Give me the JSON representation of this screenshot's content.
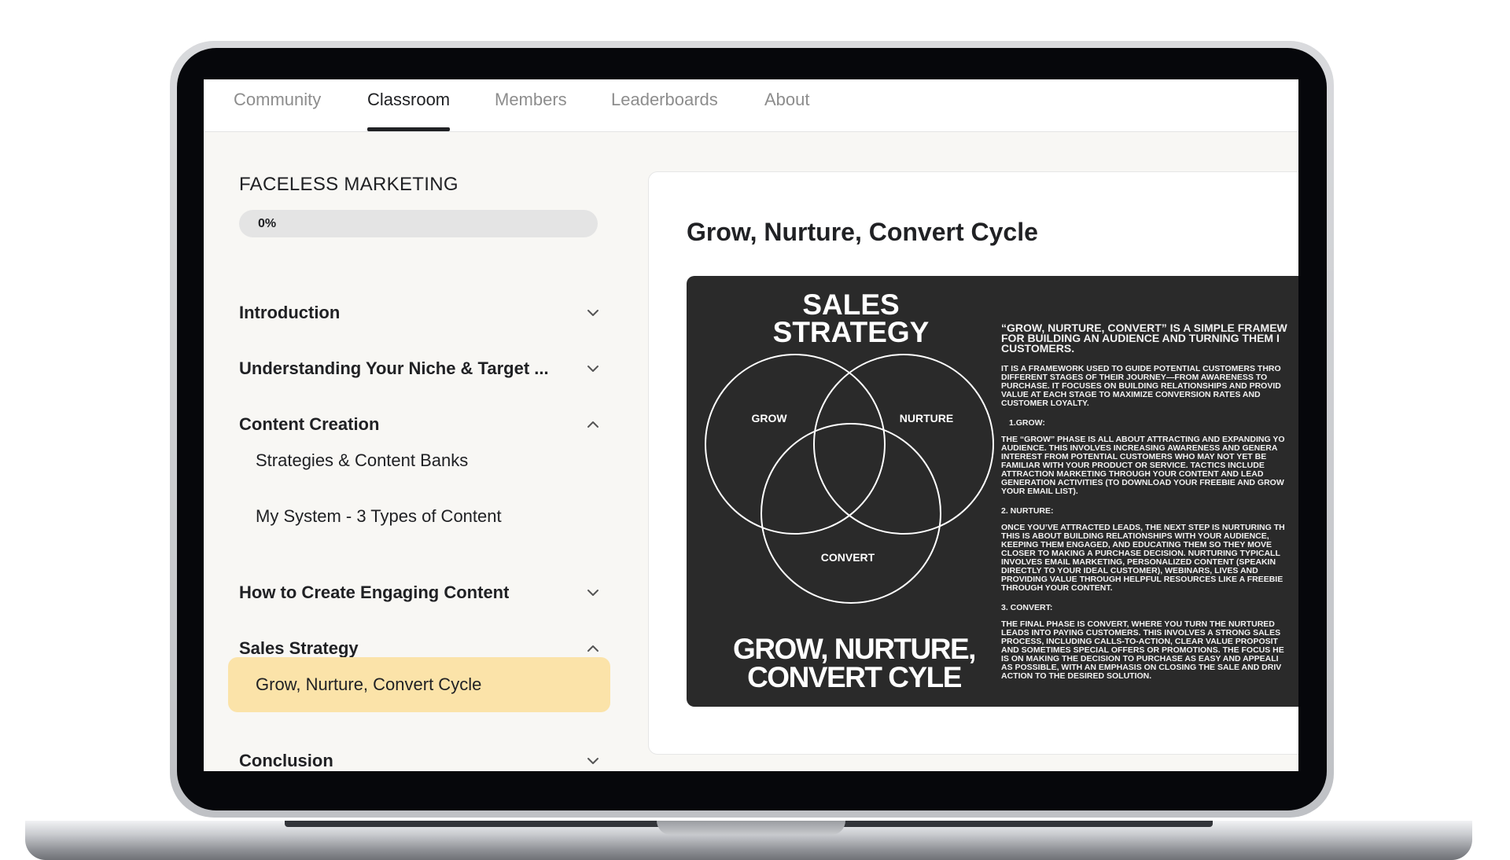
{
  "nav": {
    "tabs": [
      {
        "label": "Community"
      },
      {
        "label": "Classroom"
      },
      {
        "label": "Members"
      },
      {
        "label": "Leaderboards"
      },
      {
        "label": "About"
      }
    ]
  },
  "course": {
    "title": "FACELESS MARKETING",
    "progress_label": "0%",
    "progress_fraction": 0
  },
  "sections": [
    {
      "label": "Introduction",
      "expanded": false
    },
    {
      "label": "Understanding Your Niche & Target ...",
      "expanded": false
    },
    {
      "label": "Content Creation",
      "expanded": true,
      "lessons": [
        {
          "label": "Strategies & Content Banks"
        },
        {
          "label": "My System - 3 Types of Content"
        }
      ]
    },
    {
      "label": "How to Create Engaging Content",
      "expanded": false
    },
    {
      "label": "Sales Strategy",
      "expanded": true,
      "lessons": [
        {
          "label": "Grow, Nurture, Convert Cycle",
          "active": true
        }
      ]
    },
    {
      "label": "Conclusion",
      "expanded": false
    }
  ],
  "lesson": {
    "heading": "Grow, Nurture, Convert Cycle",
    "slide": {
      "title_line1": "SALES",
      "title_line2": "STRATEGY",
      "circle_grow": "GROW",
      "circle_nurture": "NURTURE",
      "circle_convert": "CONVERT",
      "bottom_line1": "GROW, NURTURE,",
      "bottom_line2": "CONVERT CYLE",
      "lead": [
        "“GROW, NURTURE, CONVERT” IS A SIMPLE FRAMEW",
        "FOR BUILDING AN AUDIENCE AND TURNING THEM I",
        "CUSTOMERS."
      ],
      "intro": [
        "IT IS A FRAMEWORK USED TO GUIDE POTENTIAL CUSTOMERS THRO",
        "DIFFERENT STAGES OF THEIR JOURNEY—FROM AWARENESS TO",
        "PURCHASE. IT FOCUSES ON BUILDING RELATIONSHIPS AND PROVID",
        "VALUE AT EACH STAGE TO MAXIMIZE CONVERSION RATES AND",
        "CUSTOMER LOYALTY."
      ],
      "h1": "1.GROW:",
      "p1": [
        "THE “GROW” PHASE IS ALL ABOUT ATTRACTING AND EXPANDING YO",
        "AUDIENCE. THIS INVOLVES INCREASING AWARENESS AND GENERA",
        "INTEREST FROM POTENTIAL CUSTOMERS WHO MAY NOT YET BE",
        "FAMILIAR WITH YOUR PRODUCT OR SERVICE. TACTICS INCLUDE",
        "ATTRACTION MARKETING THROUGH YOUR CONTENT AND LEAD",
        "GENERATION ACTIVITIES (TO DOWNLOAD YOUR FREEBIE AND GROW",
        "YOUR EMAIL LIST)."
      ],
      "h2": "2. NURTURE:",
      "p2": [
        "ONCE YOU’VE ATTRACTED LEADS, THE NEXT STEP IS NURTURING TH",
        "THIS IS ABOUT BUILDING RELATIONSHIPS WITH YOUR AUDIENCE,",
        "KEEPING THEM ENGAGED, AND EDUCATING THEM SO THEY MOVE",
        "CLOSER TO MAKING A PURCHASE DECISION. NURTURING TYPICALL",
        "INVOLVES EMAIL MARKETING, PERSONALIZED CONTENT (SPEAKIN",
        "DIRECTLY TO YOUR IDEAL CUSTOMER), WEBINARS, LIVES AND",
        "PROVIDING VALUE THROUGH HELPFUL RESOURCES LIKE A FREEBIE",
        "THROUGH YOUR CONTENT."
      ],
      "h3": "3. CONVERT:",
      "p3": [
        "THE FINAL PHASE IS CONVERT, WHERE YOU TURN THE NURTURED",
        "LEADS INTO PAYING CUSTOMERS. THIS INVOLVES A STRONG SALES",
        "PROCESS, INCLUDING CALLS-TO-ACTION, CLEAR VALUE PROPOSIT",
        "AND SOMETIMES SPECIAL OFFERS OR PROMOTIONS. THE FOCUS HE",
        "IS ON MAKING THE DECISION TO PURCHASE AS EASY AND APPEALI",
        "AS POSSIBLE, WITH AN EMPHASIS ON CLOSING THE SALE AND DRIV",
        "ACTION TO THE DESIRED SOLUTION."
      ]
    }
  },
  "icons": {
    "expanded": "chevron-up-icon",
    "collapsed": "chevron-down-icon"
  },
  "colors": {
    "active_lesson_bg": "#fbe3a9",
    "slide_bg": "#2a2a2a",
    "text": "#202124",
    "tab_inactive": "#8d8d8d"
  }
}
